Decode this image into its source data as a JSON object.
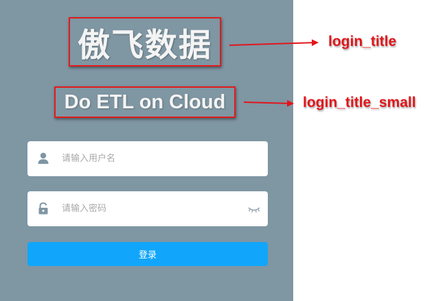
{
  "login": {
    "title": "傲飞数据",
    "subtitle": "Do ETL on Cloud",
    "username_placeholder": "请输入用户名",
    "password_placeholder": "请输入密码",
    "submit_label": "登录"
  },
  "annotations": {
    "title_label": "login_title",
    "subtitle_label": "login_title_small"
  },
  "colors": {
    "panel_bg": "#7f96a3",
    "button_bg": "#11a6fb",
    "annotation_red": "#e3151a",
    "icon_grey": "#7f96a3"
  },
  "icons": [
    "user-icon",
    "lock-icon",
    "eye-closed-icon"
  ]
}
